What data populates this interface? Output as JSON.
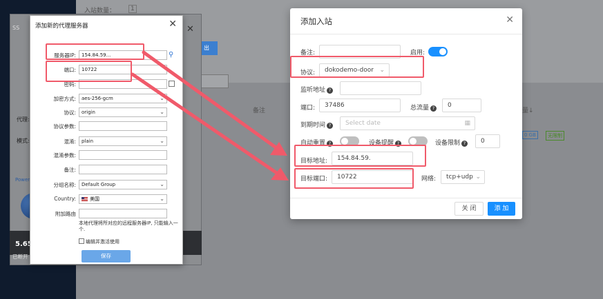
{
  "background": {
    "count_label": "入站数量：",
    "count_value": "1",
    "proxy_label": "代理:",
    "mode_label": "模式:",
    "power_label": "Power",
    "notes_header": "备注",
    "traffic_header": "量↓",
    "traffic_value": "0 GB",
    "unlimited_badge": "无限制",
    "export_button": "出",
    "speed_label": "5.65",
    "status_label": "已断开",
    "window_title": "SS"
  },
  "proxy_dialog": {
    "title": "添加新的代理服务器",
    "fields": {
      "server_ip": {
        "label": "服务器IP:",
        "value": "154.84.59..."
      },
      "port": {
        "label": "端口:",
        "value": "10722"
      },
      "password": {
        "label": "密码:",
        "value": ""
      },
      "encryption": {
        "label": "加密方式:",
        "value": "aes-256-gcm"
      },
      "protocol": {
        "label": "协议:",
        "value": "origin"
      },
      "protocol_params": {
        "label": "协议参数:",
        "value": ""
      },
      "obfs": {
        "label": "混淆:",
        "value": "plain"
      },
      "obfs_params": {
        "label": "混淆参数:",
        "value": ""
      },
      "remark": {
        "label": "备注:",
        "value": ""
      },
      "group": {
        "label": "分组名称:",
        "value": "Default Group"
      },
      "country": {
        "label": "Country:",
        "value": "美国"
      },
      "route": {
        "label": "附加路由",
        "value": ""
      }
    },
    "note": "本地代理将所对应的远程服务器IP, 只能输入一个.",
    "enable_label": "编辑并激活使用",
    "save_label": "保存"
  },
  "inbound_dialog": {
    "title": "添加入站",
    "remark_label": "备注:",
    "remark_value": "",
    "enable_label": "启用:",
    "protocol_label": "协议:",
    "protocol_value": "dokodemo-door",
    "listen_label": "监听地址",
    "listen_value": "",
    "port_label": "端口:",
    "port_value": "37486",
    "total_traffic_label": "总流量",
    "total_traffic_value": "0",
    "expire_label": "到期时间",
    "expire_placeholder": "Select date",
    "auto_reset_label": "自动重置",
    "device_alert_label": "设备提醒",
    "device_limit_label": "设备限制",
    "device_limit_value": "0",
    "target_address_label": "目标地址:",
    "target_address_value": "154.84.59.",
    "target_port_label": "目标端口:",
    "target_port_value": "10722",
    "network_label": "网络:",
    "network_value": "tcp+udp",
    "close_label": "关 闭",
    "add_label": "添 加",
    "accent_color": "#1890ff"
  },
  "annotation_color": "#f05a6a"
}
